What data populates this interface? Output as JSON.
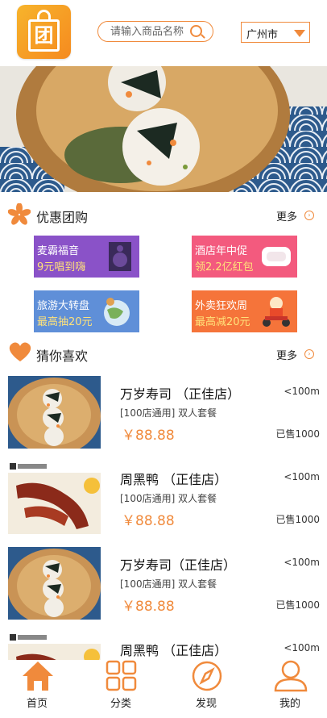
{
  "header": {
    "logo_text": "团",
    "search_placeholder": "请输入商品名称",
    "city": "广州市"
  },
  "sections": {
    "deals": {
      "title": "优惠团购",
      "more": "更多"
    },
    "guess": {
      "title": "猜你喜欢",
      "more": "更多"
    }
  },
  "promos": [
    {
      "line1": "麦霸福音",
      "line2": "9元唱到嗨",
      "bg": "#8a52c8"
    },
    {
      "line1": "酒店年中促",
      "line2": "领2.2亿红包",
      "bg": "#f35a7e"
    },
    {
      "line1": "旅游大转盘",
      "line2": "最高抽20元",
      "bg": "#5f8fd8"
    },
    {
      "line1": "外卖狂欢周",
      "line2": "最高减20元",
      "bg": "#f5743a"
    }
  ],
  "items": [
    {
      "name": "万岁寿司 （正佳店）",
      "distance": "<100m",
      "desc": "[100店通用] 双人套餐",
      "price": "￥88.88",
      "sold": "已售1000",
      "img": "sushi"
    },
    {
      "name": "周黑鸭 （正佳店）",
      "distance": "<100m",
      "desc": "[100店通用] 双人套餐",
      "price": "￥88.88",
      "sold": "已售1000",
      "img": "duck"
    },
    {
      "name": "万岁寿司（正佳店）",
      "distance": "<100m",
      "desc": "[100店通用] 双人套餐",
      "price": "￥88.88",
      "sold": "已售1000",
      "img": "sushi"
    },
    {
      "name": "周黑鸭 （正佳店）",
      "distance": "<100m",
      "desc": "",
      "price": "",
      "sold": "",
      "img": "duck"
    }
  ],
  "tabs": [
    {
      "label": "首页",
      "icon": "home-icon",
      "active": true
    },
    {
      "label": "分类",
      "icon": "grid-icon",
      "active": false
    },
    {
      "label": "发现",
      "icon": "compass-icon",
      "active": false
    },
    {
      "label": "我的",
      "icon": "user-icon",
      "active": false
    }
  ],
  "colors": {
    "accent": "#f08a3c"
  }
}
